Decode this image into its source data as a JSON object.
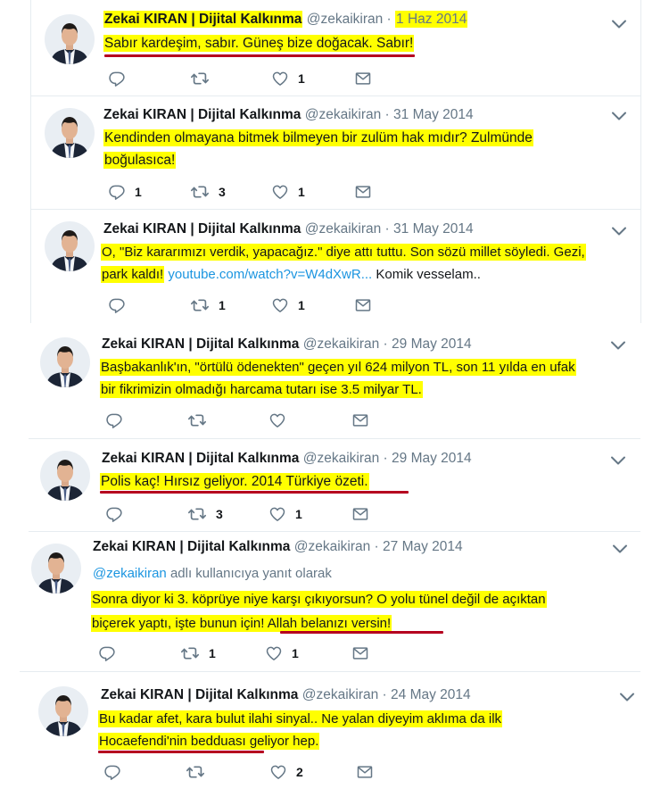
{
  "author": {
    "name": "Zekai KIRAN | Dijital Kalkınma",
    "handle": "@zekaikiran",
    "sep": "·"
  },
  "tweets": [
    {
      "date": "1 Haz 2014",
      "lines": [
        "Sabır kardeşim, sabır. Güneş bize doğacak. Sabır!"
      ],
      "reply": "",
      "retweet": "",
      "like": "1"
    },
    {
      "date": "31 May 2014",
      "lines": [
        "Kendinden olmayana bitmek bilmeyen bir zulüm hak mıdır? Zulmünde",
        "boğulasıca!"
      ],
      "reply": "1",
      "retweet": "3",
      "like": "1"
    },
    {
      "date": "31 May 2014",
      "lines": [
        "O, \"Biz kararımızı verdik, yapacağız.\" diye attı tuttu. Son sözü millet söyledi. Gezi,",
        "park kaldı!"
      ],
      "link": "youtube.com/watch?v=W4dXwR...",
      "tail": "Komik vesselam..",
      "reply": "",
      "retweet": "1",
      "like": "1"
    },
    {
      "date": "29 May 2014",
      "lines": [
        "Başbakanlık'ın, \"örtülü ödenekten\" geçen yıl 624 milyon TL, son 11 yılda en ufak",
        "bir fikrimizin olmadığı harcama tutarı ise 3.5 milyar TL."
      ],
      "reply": "",
      "retweet": "",
      "like": ""
    },
    {
      "date": "29 May 2014",
      "lines": [
        "Polis kaç! Hırsız geliyor. 2014 Türkiye özeti."
      ],
      "reply": "",
      "retweet": "3",
      "like": "1"
    },
    {
      "date": "27 May 2014",
      "reply_to_handle": "@zekaikiran",
      "reply_to_text": "adlı kullanıcıya yanıt olarak",
      "lines": [
        "Sonra diyor ki 3. köprüye niye karşı çıkıyorsun? O yolu tünel değil de açıktan",
        "biçerek yaptı, işte bunun için! Allah belanızı versin!"
      ],
      "reply": "",
      "retweet": "1",
      "like": "1"
    },
    {
      "date": "24 May 2014",
      "lines": [
        "Bu kadar afet, kara bulut ilahi sinyal.. Ne yalan diyeyim aklıma da ilk",
        "Hocaefendi'nin bedduası geliyor hep."
      ],
      "reply": "",
      "retweet": "",
      "like": "2"
    }
  ],
  "icons": [
    "reply-icon",
    "retweet-icon",
    "like-icon",
    "dm-icon",
    "caret-down-icon"
  ],
  "colors": {
    "highlight": "#ffff00",
    "underline": "#b5001f",
    "link": "#1b95e0",
    "muted": "#657786",
    "border": "#e6ecf0"
  }
}
